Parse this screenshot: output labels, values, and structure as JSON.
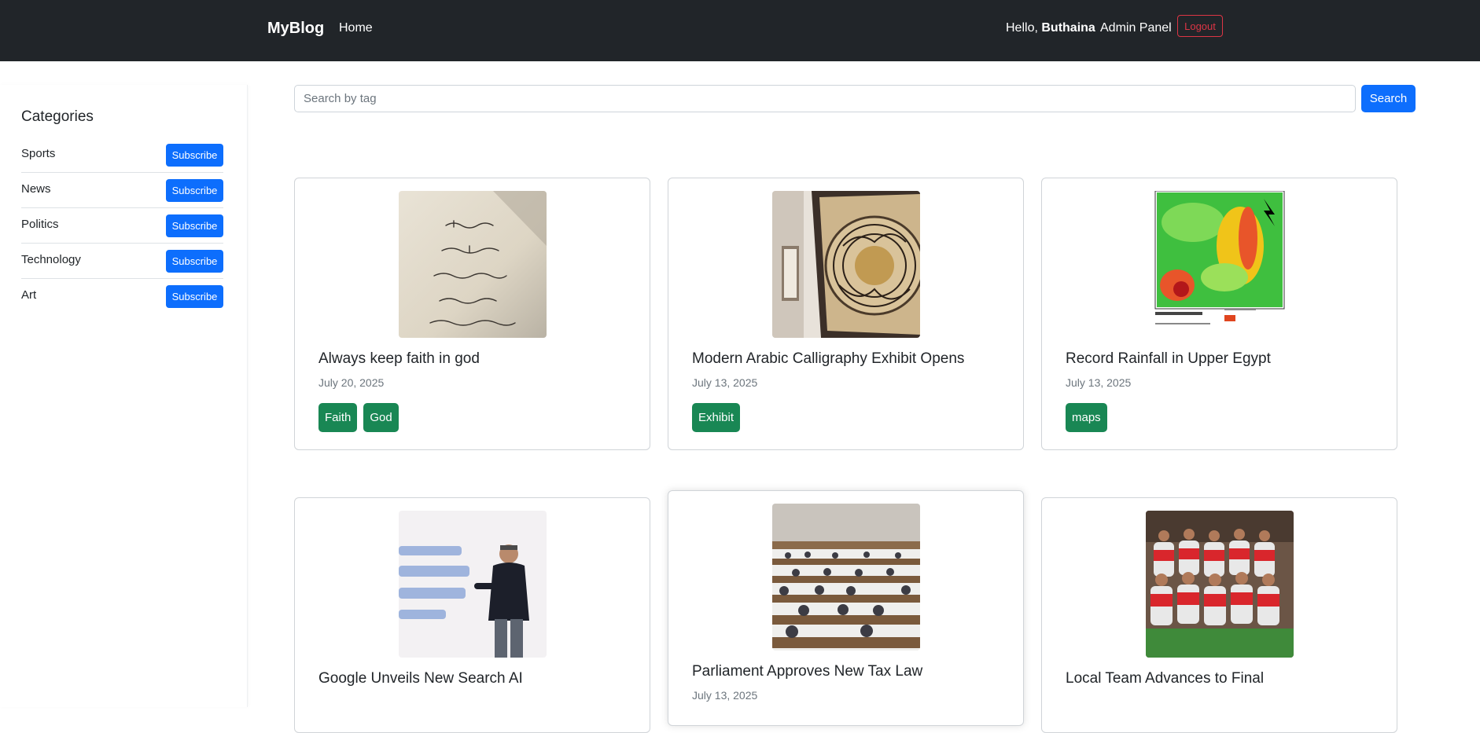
{
  "navbar": {
    "brand": "MyBlog",
    "home": "Home",
    "hello_prefix": "Hello,",
    "username": "Buthaina",
    "admin": "Admin Panel",
    "logout": "Logout"
  },
  "sidebar": {
    "title": "Categories",
    "subscribe_label": "Subscribe",
    "categories": [
      {
        "label": "Sports"
      },
      {
        "label": "News"
      },
      {
        "label": "Politics"
      },
      {
        "label": "Technology"
      },
      {
        "label": "Art"
      }
    ]
  },
  "search": {
    "placeholder": "Search by tag",
    "button": "Search"
  },
  "posts": [
    {
      "title": "Always keep faith in god",
      "date": "July 20, 2025",
      "tags": [
        "Faith",
        "God"
      ],
      "image": "arabic-quote-wall"
    },
    {
      "title": "Modern Arabic Calligraphy Exhibit Opens",
      "date": "July 13, 2025",
      "tags": [
        "Exhibit"
      ],
      "image": "calligraphy-frame"
    },
    {
      "title": "Record Rainfall in Upper Egypt",
      "date": "July 13, 2025",
      "tags": [
        "maps"
      ],
      "image": "egypt-rainfall-map"
    },
    {
      "title": "Google Unveils New Search AI",
      "date": "",
      "tags": [],
      "image": "speaker-on-stage"
    },
    {
      "title": "Parliament Approves New Tax Law",
      "date": "July 13, 2025",
      "tags": [],
      "image": "parliament-hall"
    },
    {
      "title": "Local Team Advances to Final",
      "date": "",
      "tags": [],
      "image": "football-team"
    }
  ],
  "colors": {
    "navbar": "#212529",
    "primary": "#0d6efd",
    "tag": "#198754",
    "danger": "#dc3545"
  }
}
